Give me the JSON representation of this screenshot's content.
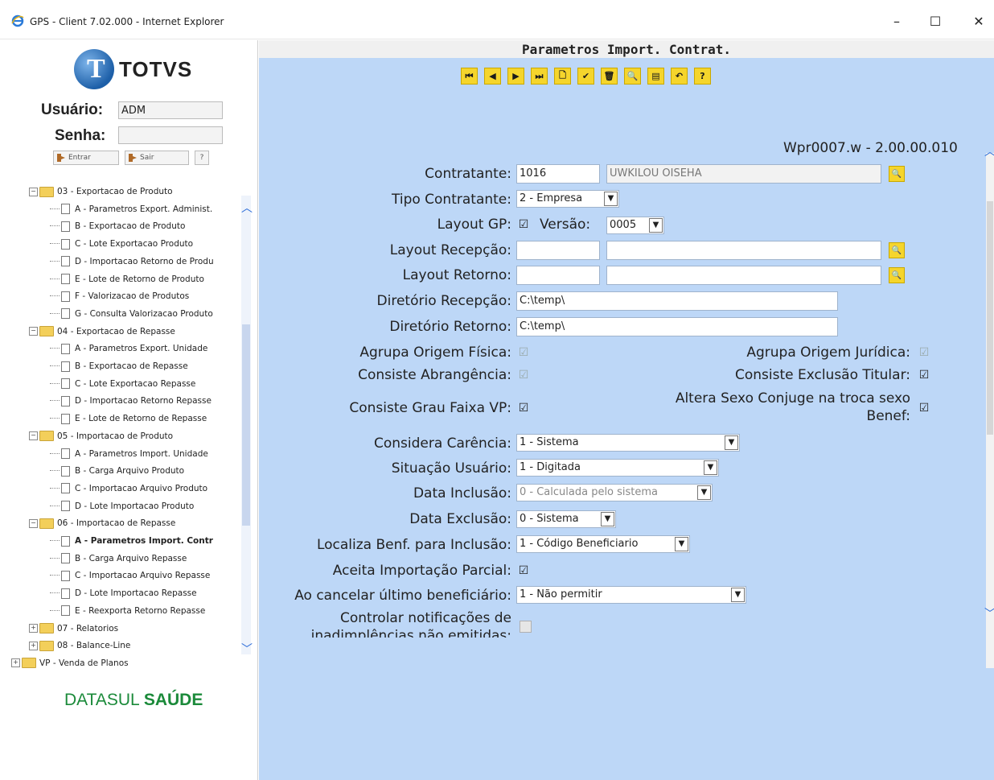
{
  "window": {
    "title": "GPS - Client 7.02.000 - Internet Explorer",
    "minimize": "–",
    "maximize": "☐",
    "close": "✕"
  },
  "login": {
    "brand": "TOTVS",
    "user_label": "Usuário:",
    "user_value": "ADM",
    "password_label": "Senha:",
    "enter_label": "Entrar",
    "exit_label": "Sair",
    "help_label": "?"
  },
  "tree": [
    {
      "label": "03 - Exportacao de Produto",
      "type": "folder"
    },
    {
      "label": "A - Parametros Export. Administ.",
      "type": "doc"
    },
    {
      "label": "B - Exportacao de Produto",
      "type": "doc"
    },
    {
      "label": "C - Lote Exportacao Produto",
      "type": "doc"
    },
    {
      "label": "D - Importacao Retorno de Produ",
      "type": "doc"
    },
    {
      "label": "E - Lote de Retorno de Produto",
      "type": "doc"
    },
    {
      "label": "F - Valorizacao de Produtos",
      "type": "doc"
    },
    {
      "label": "G - Consulta Valorizacao Produto",
      "type": "doc"
    },
    {
      "label": "04 - Exportacao de Repasse",
      "type": "folder"
    },
    {
      "label": "A - Parametros Export. Unidade",
      "type": "doc"
    },
    {
      "label": "B - Exportacao de Repasse",
      "type": "doc"
    },
    {
      "label": "C - Lote Exportacao Repasse",
      "type": "doc"
    },
    {
      "label": "D - Importacao Retorno Repasse",
      "type": "doc"
    },
    {
      "label": "E - Lote de Retorno de Repasse",
      "type": "doc"
    },
    {
      "label": "05 - Importacao de Produto",
      "type": "folder"
    },
    {
      "label": "A - Parametros Import. Unidade",
      "type": "doc"
    },
    {
      "label": "B - Carga Arquivo Produto",
      "type": "doc"
    },
    {
      "label": "C - Importacao Arquivo Produto",
      "type": "doc"
    },
    {
      "label": "D - Lote Importacao Produto",
      "type": "doc"
    },
    {
      "label": "06 - Importacao de Repasse",
      "type": "folder"
    },
    {
      "label": "A - Parametros Import. Contr",
      "type": "doc",
      "selected": true
    },
    {
      "label": "B - Carga Arquivo Repasse",
      "type": "doc"
    },
    {
      "label": "C - Importacao Arquivo Repasse",
      "type": "doc"
    },
    {
      "label": "D - Lote Importacao Repasse",
      "type": "doc"
    },
    {
      "label": "E - Reexporta Retorno Repasse",
      "type": "doc"
    },
    {
      "label": "07 - Relatorios",
      "type": "folder"
    },
    {
      "label": "08 - Balance-Line",
      "type": "folder"
    },
    {
      "label": "VP - Venda de Planos",
      "type": "folder"
    }
  ],
  "datasul": {
    "part1": "DATASUL",
    "part2": "SAÚDE"
  },
  "form": {
    "title": "Parametros Import. Contrat.",
    "program_version": "Wpr0007.w - 2.00.00.010",
    "contratante_label": "Contratante:",
    "contratante_code": "1016",
    "contratante_name": "UWKILOU OISEHA",
    "tipo_contratante_label": "Tipo Contratante:",
    "tipo_contratante_value": "2 - Empresa",
    "layout_gp_label": "Layout GP:",
    "versao_label": "Versão:",
    "versao_value": "0005",
    "layout_recepcao_label": "Layout Recepção:",
    "layout_retorno_label": "Layout Retorno:",
    "diretorio_recepcao_label": "Diretório Recepção:",
    "diretorio_recepcao_value": "C:\\temp\\",
    "diretorio_retorno_label": "Diretório Retorno:",
    "diretorio_retorno_value": "C:\\temp\\",
    "agrupa_fisica_label": "Agrupa Origem Física:",
    "agrupa_juridica_label": "Agrupa Origem Jurídica:",
    "consiste_abrangencia_label": "Consiste Abrangência:",
    "consiste_exclusao_label": "Consiste Exclusão Titular:",
    "consiste_grau_label": "Consiste Grau Faixa VP:",
    "altera_sexo_label_1": "Altera Sexo Conjuge na troca sexo",
    "altera_sexo_label_2": "Benef:",
    "considera_carencia_label": "Considera Carência:",
    "considera_carencia_value": "1 - Sistema",
    "situacao_usuario_label": "Situação Usuário:",
    "situacao_usuario_value": "1 - Digitada",
    "data_inclusao_label": "Data Inclusão:",
    "data_inclusao_value": "0 - Calculada pelo sistema",
    "data_exclusao_label": "Data Exclusão:",
    "data_exclusao_value": "0 - Sistema",
    "localiza_benf_label": "Localiza Benf. para Inclusão:",
    "localiza_benf_value": "1 - Código Beneficiario",
    "aceita_parcial_label": "Aceita Importação Parcial:",
    "ao_cancelar_label": "Ao cancelar último beneficiário:",
    "ao_cancelar_value": "1 - Não permitir",
    "controlar_label_1": "Controlar notificações de",
    "controlar_label_2": "inadimplências não emitidas:"
  },
  "toolbar": [
    "⏮",
    "◀",
    "▶",
    "⏭",
    "🗋",
    "✔",
    "🗑",
    "🔍",
    "▤",
    "↶",
    "?"
  ]
}
